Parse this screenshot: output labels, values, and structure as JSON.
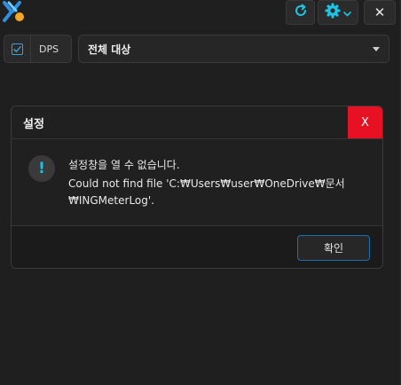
{
  "toolbar": {
    "logo_icon": "app-logo-icon",
    "refresh_icon": "refresh-icon",
    "settings_icon": "gear-icon",
    "close_label": "✕",
    "accent": "#1fc3e6"
  },
  "filters": {
    "dps_checked": true,
    "dps_label": "DPS",
    "target_value": "전체 대상"
  },
  "dialog": {
    "title": "설정",
    "close_label": "X",
    "alert_icon": "!",
    "message_lines": [
      "설정창을 열 수 없습니다.",
      "Could not find file 'C:₩Users₩user₩OneDrive₩문서",
      "₩INGMeterLog'."
    ],
    "ok_label": "확인",
    "close_color": "#e81123"
  }
}
